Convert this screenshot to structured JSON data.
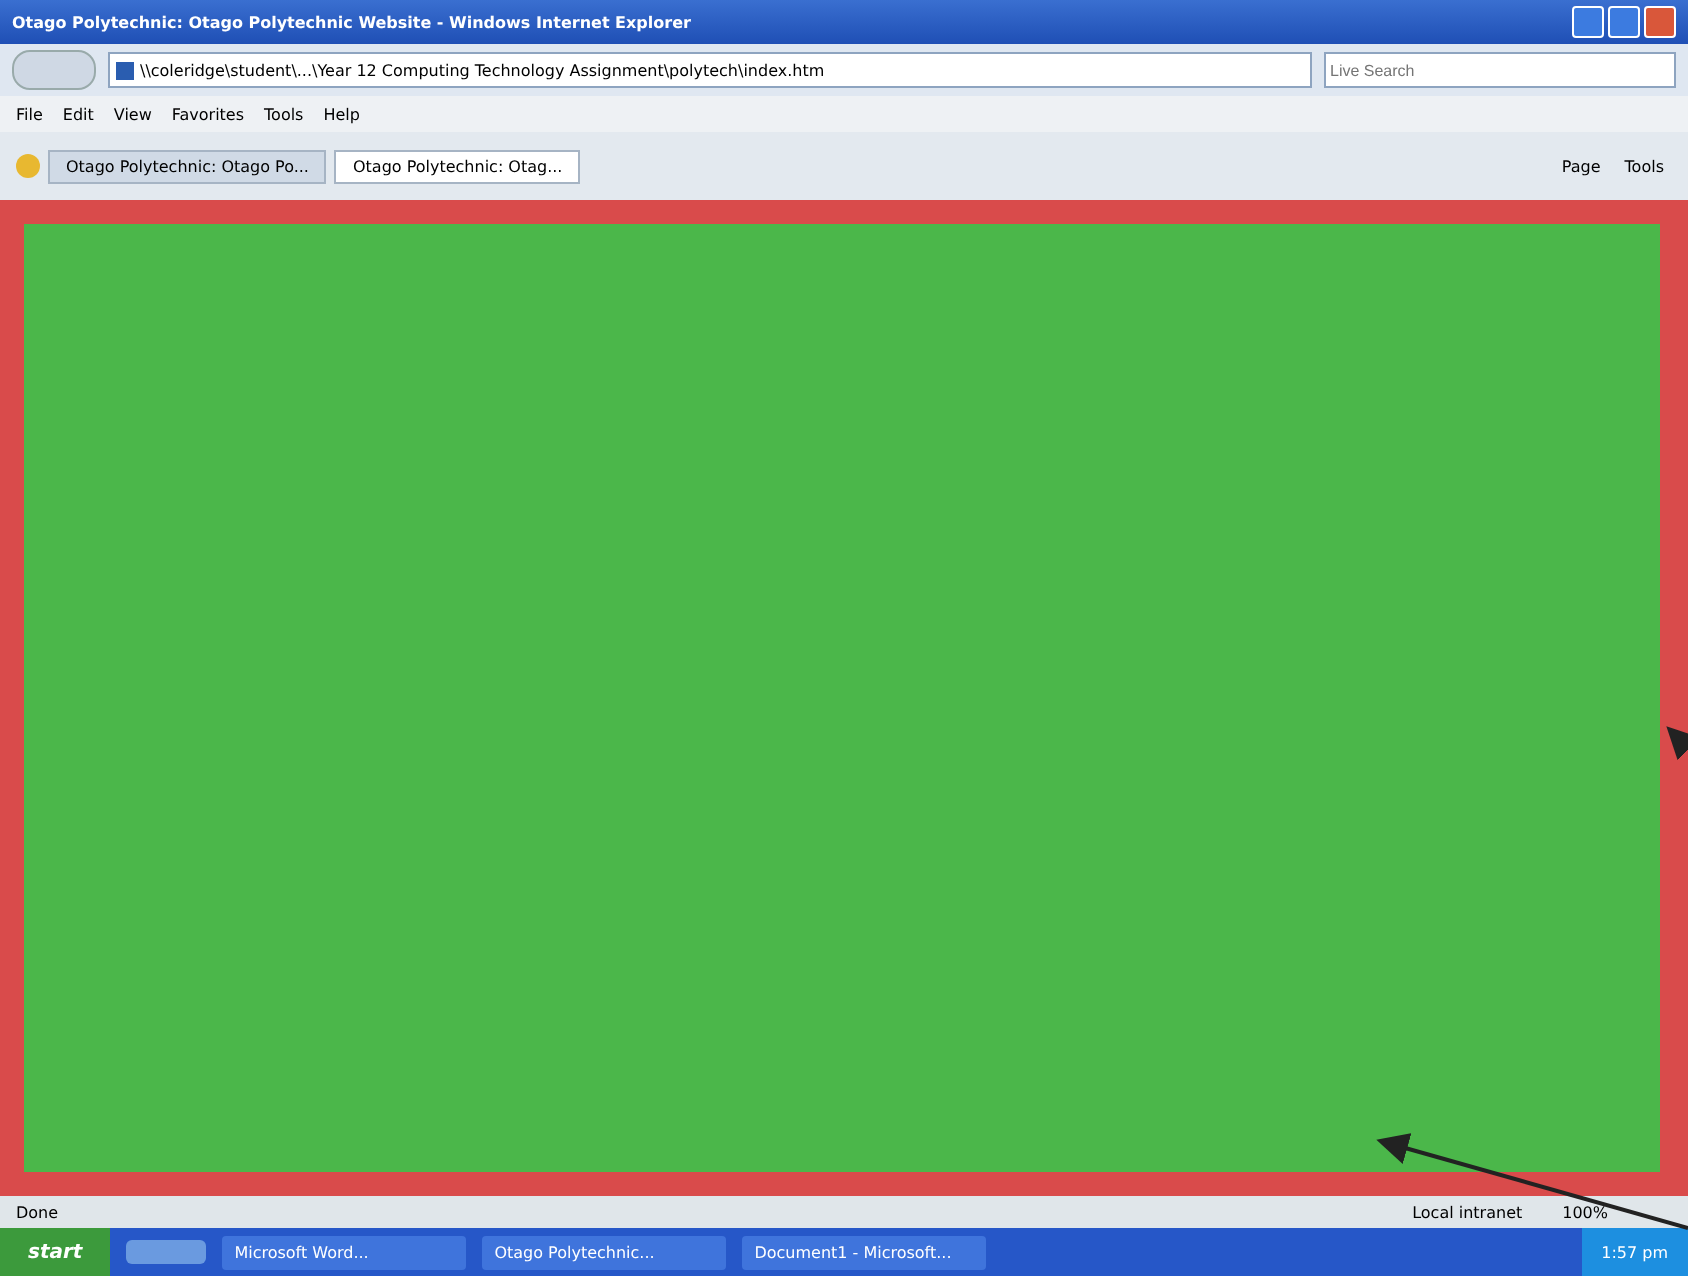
{
  "window": {
    "title": "Otago Polytechnic: Otago Polytechnic Website - Windows Internet Explorer"
  },
  "address_bar": {
    "value": "\\\\coleridge\\student\\...\\Year 12 Computing Technology Assignment\\polytech\\index.htm"
  },
  "search": {
    "placeholder": "Live Search"
  },
  "menu": [
    "File",
    "Edit",
    "View",
    "Favorites",
    "Tools",
    "Help"
  ],
  "tabs": [
    {
      "label": "Otago Polytechnic: Otago Po...",
      "selected": false
    },
    {
      "label": "Otago Polytechnic: Otag...",
      "selected": true
    }
  ],
  "command_bar": [
    "Page",
    "Tools"
  ],
  "status_bar": {
    "status": "Done",
    "zone": "Local intranet",
    "zoom": "100%"
  },
  "taskbar": {
    "start": "start",
    "items": [
      "Microsoft Word...",
      "Otago Polytechnic...",
      "Document1 - Microsoft..."
    ],
    "clock": "1:57 pm"
  }
}
